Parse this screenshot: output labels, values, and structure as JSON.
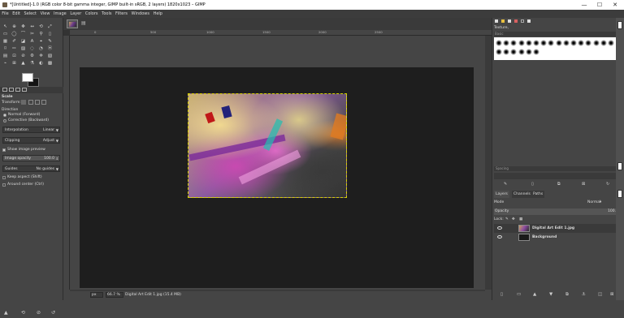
{
  "window": {
    "title": "*[Untitled]-1.0 (RGB color 8-bit gamma integer, GIMP built-in sRGB, 2 layers) 1820x1023 – GIMP",
    "minimize": "—",
    "maximize": "☐",
    "close": "✕"
  },
  "menu": [
    "File",
    "Edit",
    "Select",
    "View",
    "Image",
    "Layer",
    "Colors",
    "Tools",
    "Filters",
    "Windows",
    "Help"
  ],
  "tool_icons": [
    "↖",
    "⊕",
    "✥",
    "↔",
    "⟲",
    "⤢",
    "▭",
    "◯",
    "⌒",
    "✂",
    "⚲",
    "▯",
    "▦",
    "✐",
    "◪",
    "A",
    "⌖",
    "✎",
    "⌑",
    "✏",
    "▨",
    "◌",
    "◔",
    "⦿",
    "▤",
    "⊡",
    "⊘",
    "⚙",
    "✲",
    "▧",
    "⌁",
    "⊞",
    "▲",
    "⚗",
    "◐",
    "▩"
  ],
  "tool_options": {
    "title": "Scale",
    "transform_label": "Transform:",
    "direction_label": "Direction",
    "dir_normal": "Normal (Forward)",
    "dir_corrective": "Corrective (Backward)",
    "interpolation_label": "Interpolation",
    "interpolation_value": "Linear",
    "clipping_label": "Clipping",
    "clipping_value": "Adjust",
    "show_preview": "Show image preview",
    "image_opacity_label": "Image opacity",
    "image_opacity_value": "100.0",
    "guides_label": "Guides",
    "guides_value": "No guides",
    "keep_aspect": "Keep aspect (Shift)",
    "around_center": "Around center (Ctrl)"
  },
  "rulers": {
    "h": [
      "0",
      "500",
      "1000",
      "1500",
      "2000",
      "2500"
    ]
  },
  "status": {
    "unit": "px",
    "zoom": "66.7 %",
    "message": "Digital Art Edit 1.jpg (15.4 MB)"
  },
  "brushes": {
    "label": "Texture,",
    "filter": "Basic",
    "spacing_label": "Spacing"
  },
  "layers": {
    "tabs": [
      "Layers",
      "Channels",
      "Paths"
    ],
    "mode_label": "Mode",
    "mode_value": "Normal",
    "opacity_label": "Opacity",
    "opacity_value": "100.0",
    "lock_label": "Lock:",
    "items": [
      {
        "name": "Digital Art Edit 1.jpg"
      },
      {
        "name": "Background"
      }
    ]
  },
  "colors": {
    "accent": "#d4d000",
    "panel": "#454545",
    "canvas": "#1e1e1e"
  }
}
